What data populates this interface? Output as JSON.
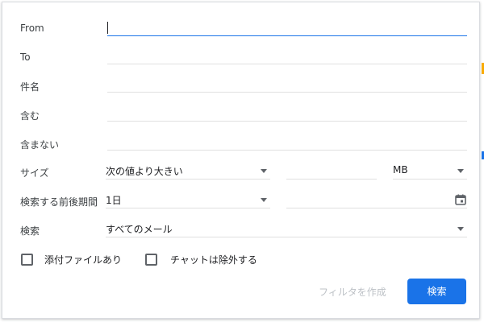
{
  "form": {
    "from_label": "From",
    "from_value": "",
    "to_label": "To",
    "to_value": "",
    "subject_label": "件名",
    "subject_value": "",
    "has_words_label": "含む",
    "has_words_value": "",
    "doesnt_have_label": "含まない",
    "doesnt_have_value": "",
    "size_label": "サイズ",
    "size_operator": "次の値より大きい",
    "size_value": "",
    "size_unit": "MB",
    "date_label": "検索する前後期間",
    "date_range": "1日",
    "date_value": "",
    "search_label": "検索",
    "search_scope": "すべてのメール",
    "has_attachment_label": "添付ファイルあり",
    "has_attachment_checked": false,
    "exclude_chats_label": "チャットは除外する",
    "exclude_chats_checked": false
  },
  "actions": {
    "create_filter_label": "フィルタを作成",
    "search_button_label": "検索"
  },
  "icons": {
    "calendar": "calendar-icon",
    "dropdown": "chevron-down-icon"
  },
  "colors": {
    "accent": "#1a73e8",
    "disabled_text": "#bdc1c6",
    "edge_marks": [
      "#f9ab00",
      "#1a73e8"
    ]
  }
}
